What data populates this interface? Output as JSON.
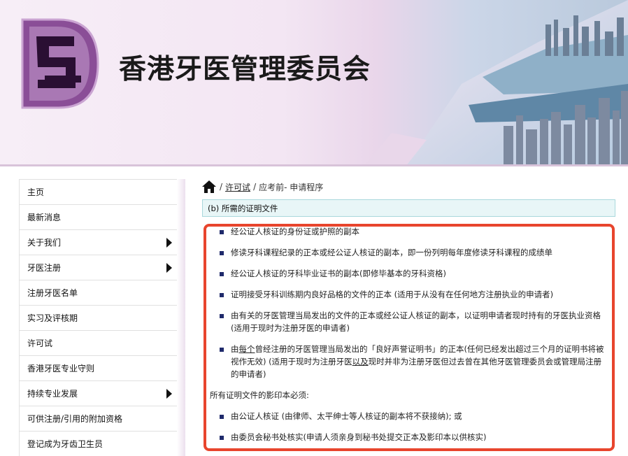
{
  "header": {
    "title": "香港牙医管理委员会"
  },
  "sidebar": {
    "items": [
      {
        "label": "主页",
        "has_arrow": false
      },
      {
        "label": "最新消息",
        "has_arrow": false
      },
      {
        "label": "关于我们",
        "has_arrow": true
      },
      {
        "label": "牙医注册",
        "has_arrow": true
      },
      {
        "label": "注册牙医名单",
        "has_arrow": false
      },
      {
        "label": "实习及评核期",
        "has_arrow": false
      },
      {
        "label": "许可试",
        "has_arrow": false
      },
      {
        "label": "香港牙医专业守则",
        "has_arrow": false
      },
      {
        "label": "持续专业发展",
        "has_arrow": true
      },
      {
        "label": "可供注册/引用的附加资格",
        "has_arrow": false
      },
      {
        "label": "登记成为牙齿卫生员",
        "has_arrow": false
      }
    ]
  },
  "breadcrumb": {
    "sep1": "/",
    "link": "许可试",
    "sep2": "/",
    "current": "应考前- 申请程序"
  },
  "section": {
    "title": "(b) 所需的证明文件"
  },
  "documents": [
    "经公证人核证的身份证或护照的副本",
    "修读牙科课程纪录的正本或经公证人核证的副本，即一份列明每年度修读牙科课程的成绩单",
    "经公证人核证的牙科毕业证书的副本(即修毕基本的牙科资格)",
    "证明接受牙科训练期内良好品格的文件的正本 (适用于从没有在任何地方注册执业的申请者)",
    "由有关的牙医管理当局发出的文件的正本或经公证人核证的副本，以证明申请者现时持有的牙医执业资格 (适用于现时为注册牙医的申请者)"
  ],
  "doc6": {
    "p1": "由",
    "p2": "每个",
    "p3": "曾经注册的牙医管理当局发出的「良好声誉证明书」的正本(任何已经发出超过三个月的证明书将被视作无效) (适用于现时为注册牙医",
    "p4": "以及",
    "p5": "现时并非为注册牙医但过去曾在其他牙医管理委员会或管理局注册的申请者)"
  },
  "copies": {
    "intro": "所有证明文件的影印本必须:",
    "items": [
      "由公证人核证 (由律师、太平绅士等人核证的副本将不获接纳); 或",
      "由委员会秘书处核实(申请人须亲身到秘书处提交正本及影印本以供核实)"
    ]
  },
  "colors": {
    "highlight_frame": "#e8452d",
    "section_bg": "#e8f6f7",
    "bullet": "#1f2a6b",
    "logo_purple": "#8a4e97"
  }
}
